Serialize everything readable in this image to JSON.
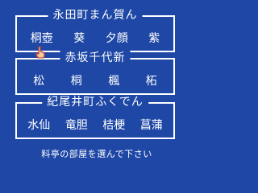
{
  "groups": [
    {
      "title": "永田町まん賀ん",
      "rooms": [
        "桐壺",
        "葵",
        "夕顔",
        "紫"
      ]
    },
    {
      "title": "赤坂千代新",
      "rooms": [
        "松",
        "桐",
        "楓",
        "柘"
      ]
    },
    {
      "title": "紀尾井町ふくでん",
      "rooms": [
        "水仙",
        "竜胆",
        "桔梗",
        "菖蒲"
      ]
    }
  ],
  "prompt": "料亭の部屋を選んで下さい",
  "colors": {
    "background": "#1f48a6",
    "text": "#ffffff",
    "cursor_skin": "#f4c9a0",
    "cursor_outline": "#c0392b"
  },
  "cursor_icon": "pointing-hand-icon"
}
